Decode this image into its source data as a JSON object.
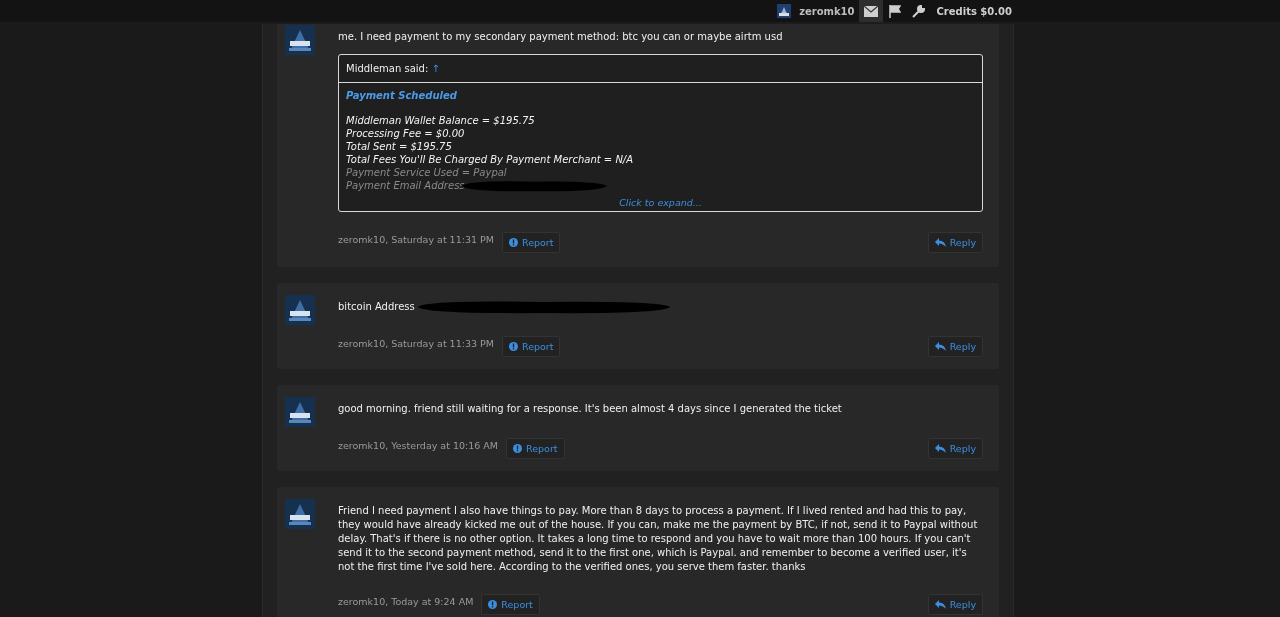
{
  "header": {
    "username": "zeromk10",
    "nav_items": [
      {
        "kind": "mail",
        "selected": true
      },
      {
        "kind": "flag",
        "selected": false
      },
      {
        "kind": "wrench",
        "selected": false
      }
    ],
    "credits": "Credits $0.00"
  },
  "posts": [
    {
      "message": "me. I need payment to my secondary payment method: btc you can or maybe airtm usd",
      "redacted": false,
      "quote": {
        "author": "Middleman said:",
        "arrow": "↑",
        "title": "Payment Scheduled",
        "lines": [
          {
            "text": "Middleman Wallet Balance = $195.75",
            "faded": false,
            "redacted": false
          },
          {
            "text": "Processing Fee = $0.00",
            "faded": false,
            "redacted": false
          },
          {
            "text": "Total Sent = $195.75",
            "faded": false,
            "redacted": false
          },
          {
            "text": "Total Fees You'll Be Charged By Payment Merchant = N/A",
            "faded": false,
            "redacted": false
          },
          {
            "text": "Payment Service Used = Paypal",
            "faded": true,
            "redacted": false
          },
          {
            "text": "Payment Email Address",
            "faded": true,
            "redacted": true
          }
        ],
        "expand": "Click to expand..."
      },
      "meta": "zeromk10, Saturday at 11:31 PM",
      "report": "Report",
      "reply": "Reply"
    },
    {
      "message": "bitcoin Address",
      "redacted": true,
      "meta": "zeromk10, Saturday at 11:33 PM",
      "report": "Report",
      "reply": "Reply"
    },
    {
      "message": "good morning. friend still waiting for a response. It's been almost 4 days since I generated the ticket",
      "redacted": false,
      "meta": "zeromk10, Yesterday at 10:16 AM",
      "report": "Report",
      "reply": "Reply"
    },
    {
      "message": "Friend I need payment I also have things to pay. More than 8 days to process a payment. If I lived rented and had this to pay, they would have already kicked me out of the house. If you can, make me the payment by BTC, if not, send it to Paypal without delay. That's if there is no other option. It takes a long time to respond and you have to wait more than 100 hours. If you can't send it to the second payment method, send it to the first one, which is Paypal. and remember to become a verified user, it's not the first time I've sold here. According to the verified ones, you serve them faster. thanks",
      "redacted": false,
      "meta": "zeromk10, Today at 9:24 AM",
      "report": "Report",
      "reply": "Reply"
    }
  ]
}
